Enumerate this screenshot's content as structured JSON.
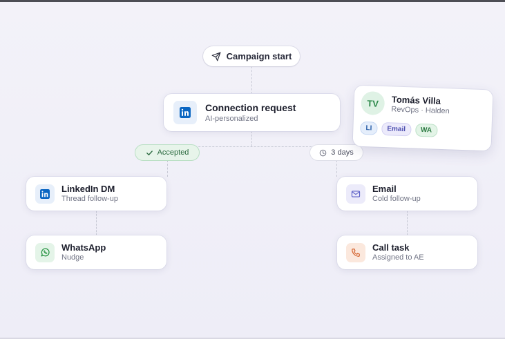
{
  "flow": {
    "start": {
      "label": "Campaign start",
      "icon": "send-icon"
    },
    "connection": {
      "title": "Connection request",
      "subtitle": "AI-personalized",
      "icon": "linkedin-icon"
    },
    "branch_accepted": {
      "label": "Accepted",
      "icon": "check-icon"
    },
    "branch_wait": {
      "label": "3 days",
      "icon": "clock-icon"
    },
    "linkedin_dm": {
      "title": "LinkedIn DM",
      "subtitle": "Thread follow-up",
      "icon": "linkedin-icon"
    },
    "whatsapp": {
      "title": "WhatsApp",
      "subtitle": "Nudge",
      "icon": "whatsapp-icon"
    },
    "email": {
      "title": "Email",
      "subtitle": "Cold follow-up",
      "icon": "mail-icon"
    },
    "call_task": {
      "title": "Call task",
      "subtitle": "Assigned to AE",
      "icon": "phone-icon"
    }
  },
  "contact": {
    "initials": "TV",
    "name": "Tomás Villa",
    "role": "RevOps · Halden",
    "tags": [
      "LI",
      "Email",
      "WA"
    ]
  },
  "colors": {
    "linkedin": "#0a66c2",
    "whatsapp": "#25a244",
    "email": "#5b5fc7",
    "call": "#d9622b",
    "accepted_bg": "#e6f4ea",
    "accepted_text": "#2c7a45"
  }
}
